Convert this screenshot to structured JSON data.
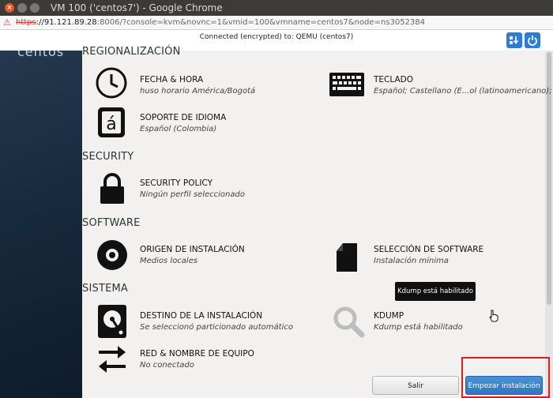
{
  "window": {
    "title": "VM 100 ('centos7') - Google Chrome"
  },
  "address": {
    "scheme": "https",
    "host": "://91.121.89.28",
    "path": ":8006/?console=kvm&novnc=1&vmid=100&vmname=centos7&node=ns3052384"
  },
  "novnc": {
    "status": "Connected (encrypted) to: QEMU (centos7)"
  },
  "sidebar": {
    "logo": "centos"
  },
  "sections": {
    "regionalizacion": "REGIONALIZACIÓN",
    "security": "SECURITY",
    "software": "SOFTWARE",
    "sistema": "SISTEMA"
  },
  "spokes": {
    "fecha": {
      "name": "FECHA & HORA",
      "status": "huso horario América/Bogotá"
    },
    "teclado": {
      "name": "TECLADO",
      "status": "Español; Castellano (E...ol (latinoamericano);"
    },
    "idioma": {
      "name": "SOPORTE DE IDIOMA",
      "status": "Español (Colombia)",
      "glyph": "á"
    },
    "security_policy": {
      "name": "SECURITY POLICY",
      "status": "Ningún perfil seleccionado"
    },
    "origen": {
      "name": "ORIGEN DE INSTALACIÓN",
      "status": "Medios locales"
    },
    "seleccion": {
      "name": "SELECCIÓN DE SOFTWARE",
      "status": "Instalación mínima"
    },
    "destino": {
      "name": "DESTINO DE LA INSTALACIÓN",
      "status": "Se seleccionó particionado automático"
    },
    "kdump": {
      "name": "KDUMP",
      "status": "Kdump está habilitado"
    },
    "red": {
      "name": "RED & NOMBRE DE EQUIPO",
      "status": "No conectado"
    }
  },
  "tooltip": "Kdump está habilitado",
  "buttons": {
    "salir": "Salir",
    "empezar": "Empezar instalación"
  },
  "colors": {
    "accent": "#2f75c0",
    "highlight": "#e01b1b"
  }
}
